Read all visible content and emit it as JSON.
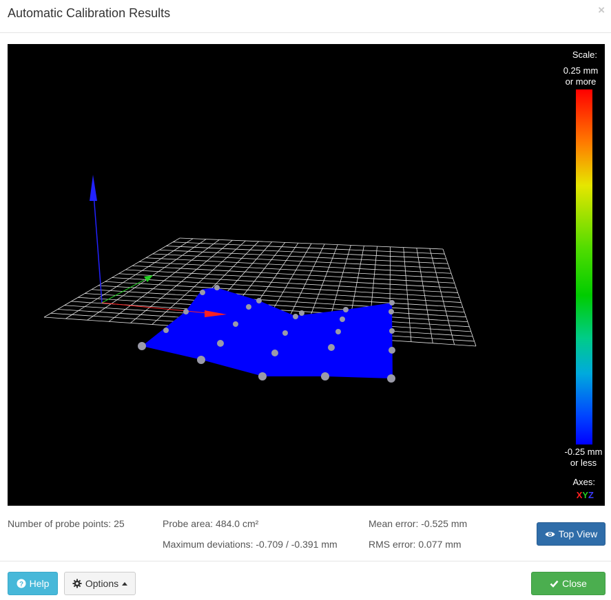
{
  "header": {
    "title": "Automatic Calibration Results",
    "close_glyph": "×"
  },
  "viewer": {
    "scale_title": "Scale:",
    "scale_max_line1": "0.25 mm",
    "scale_max_line2": "or more",
    "scale_min_line1": "-0.25 mm",
    "scale_min_line2": "or less",
    "axes_title": "Axes:",
    "axes": {
      "x": "X",
      "y": "Y",
      "z": "Z"
    },
    "background": "#000000",
    "surface_color": "#0000ff",
    "grid_color": "#ffffff"
  },
  "stats": {
    "probe_points": "Number of probe points: 25",
    "probe_area": "Probe area: 484.0 cm²",
    "max_deviations": "Maximum deviations: -0.709 / -0.391 mm",
    "mean_error": "Mean error: -0.525 mm",
    "rms_error": "RMS error: 0.077 mm"
  },
  "buttons": {
    "top_view": "Top View",
    "help": "Help",
    "options": "Options",
    "close": "Close"
  },
  "colors": {
    "top_view_bg": "#2f6da9",
    "help_bg": "#47b8d9",
    "close_bg": "#4bae4f"
  }
}
